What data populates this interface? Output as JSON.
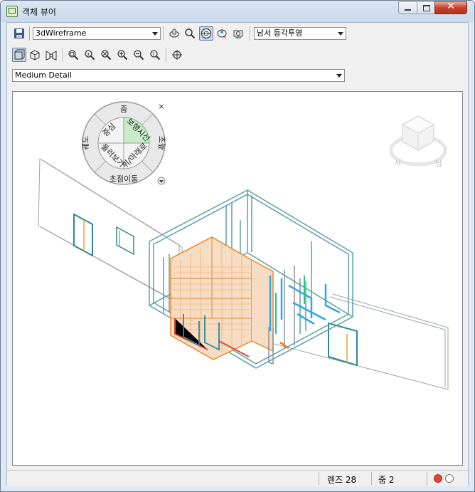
{
  "window": {
    "title": "객체 뷰어"
  },
  "toolbar1": {
    "visual_style": "3dWireframe",
    "view_direction": "남서 등각투영"
  },
  "toolbar3": {
    "detail_level": "Medium Detail"
  },
  "wheel": {
    "top": "줌",
    "left": "궤도",
    "right": "초늪",
    "bottom": "초점이동",
    "inner_tl": "중심",
    "inner_tr": "보행시선",
    "inner_bl": "둘러보기",
    "inner_br": "위/아래로",
    "close": "×"
  },
  "viewcube": {
    "left_label": "서",
    "right_label": "남"
  },
  "status": {
    "lens": "렌즈 28",
    "zoom": "줌 2"
  },
  "colors": {
    "accent_red": "#e0453a",
    "wire_teal": "#5aa0a8",
    "brick_orange": "#e8882a",
    "pipe_blue": "#2aa8e8"
  }
}
